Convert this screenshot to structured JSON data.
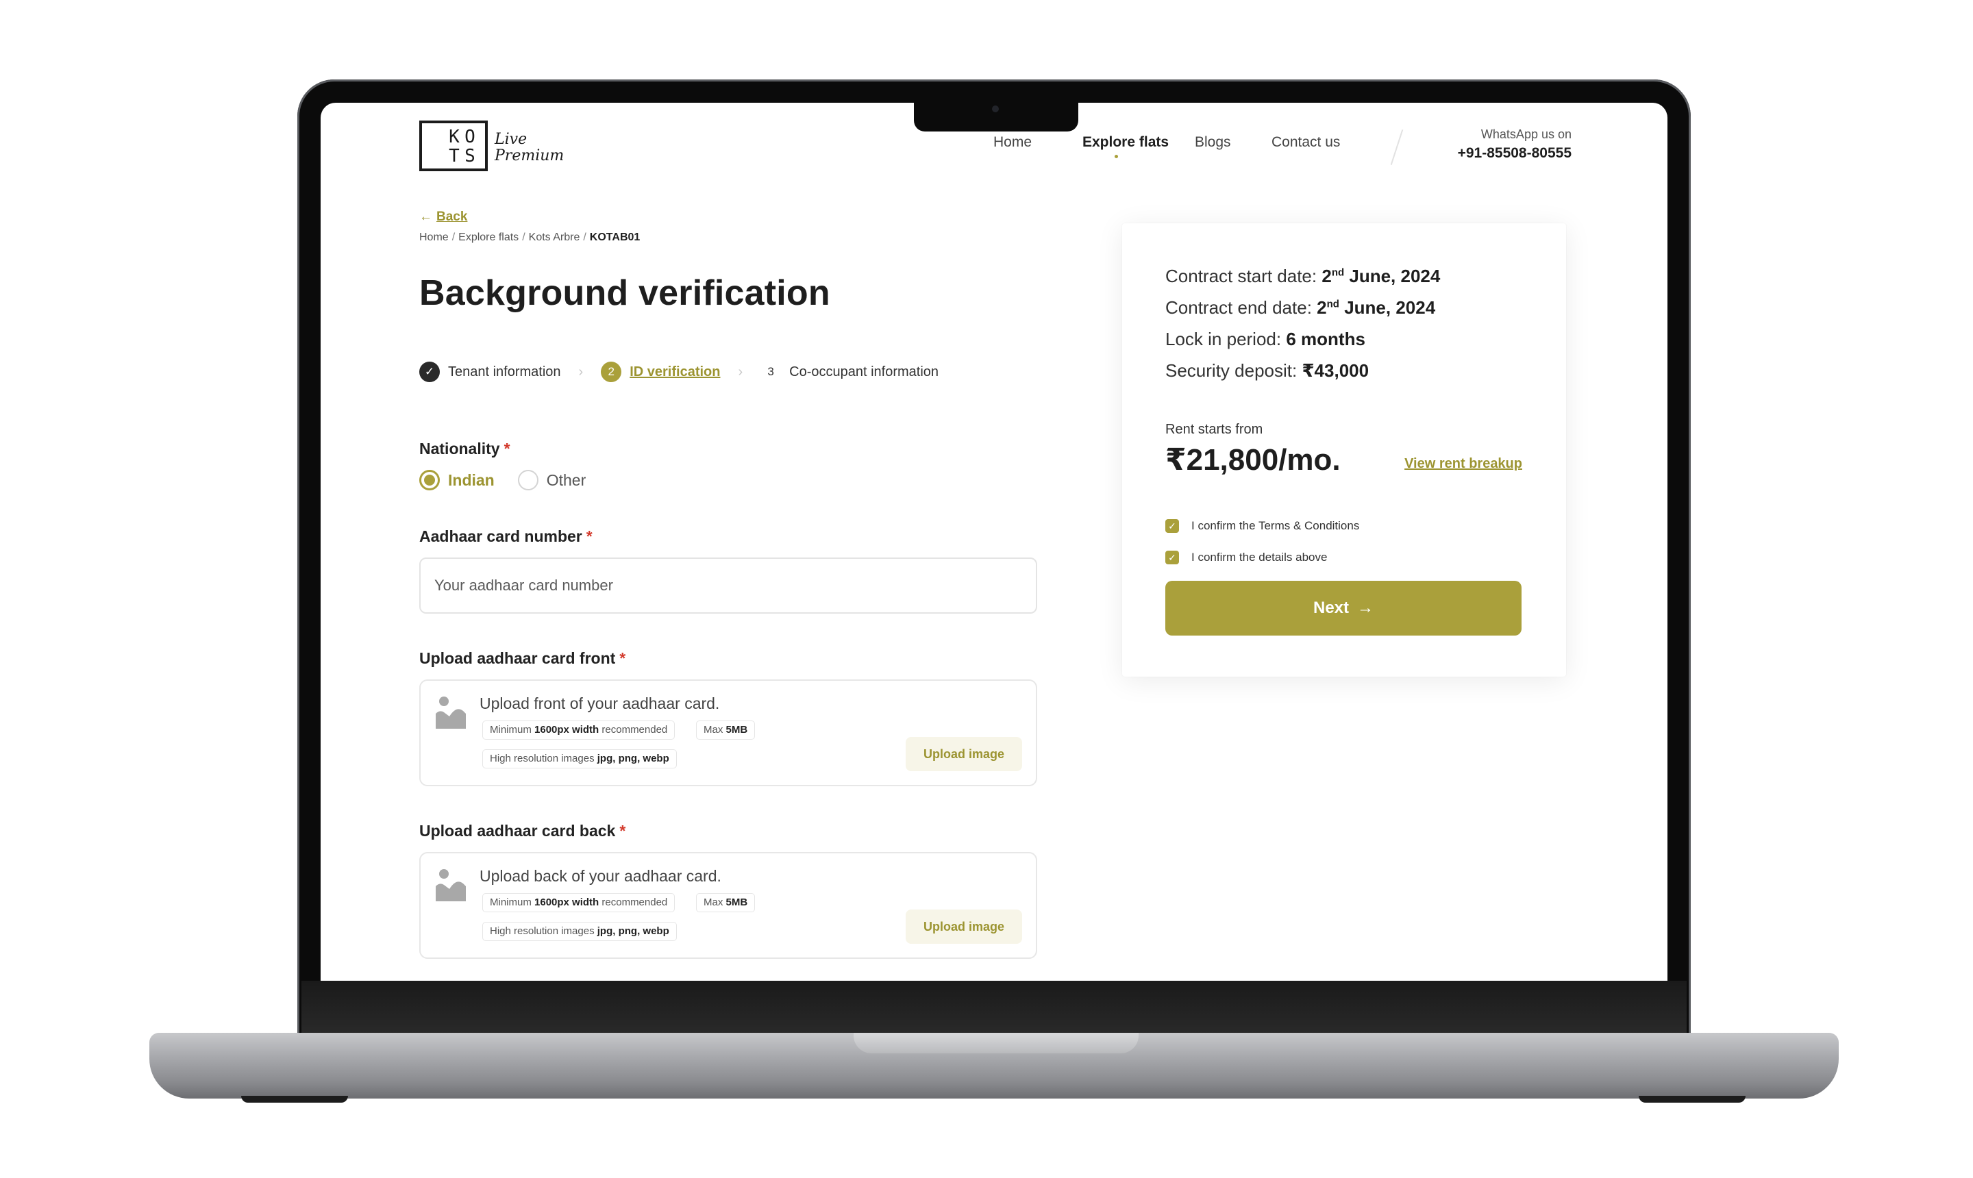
{
  "brand": {
    "logo_letters": [
      "K",
      "O",
      "T",
      "S"
    ],
    "logo_script_line1": "Live",
    "logo_script_line2": "Premium"
  },
  "nav": {
    "items": [
      {
        "label": "Home",
        "active": false
      },
      {
        "label": "Explore flats",
        "active": true
      },
      {
        "label": "Blogs",
        "active": false
      },
      {
        "label": "Contact us",
        "active": false
      }
    ],
    "whatsapp_label": "WhatsApp us on",
    "whatsapp_phone": "+91-85508-80555"
  },
  "back_label": "Back",
  "breadcrumb": [
    "Home",
    "Explore flats",
    "Kots Arbre",
    "KOTAB01"
  ],
  "page_title": "Background verification",
  "stepper": [
    {
      "number": "",
      "label": "Tenant information",
      "state": "done"
    },
    {
      "number": "2",
      "label": "ID verification",
      "state": "active"
    },
    {
      "number": "3",
      "label": "Co-occupant information",
      "state": "todo"
    }
  ],
  "form": {
    "nationality": {
      "label": "Nationality",
      "required_mark": "*",
      "options": [
        {
          "label": "Indian",
          "selected": true
        },
        {
          "label": "Other",
          "selected": false
        }
      ]
    },
    "aadhaar_number": {
      "label": "Aadhaar card number",
      "required_mark": "*",
      "value": "",
      "placeholder": "Your aadhaar card number"
    },
    "upload_front": {
      "label": "Upload aadhaar card front",
      "required_mark": "*",
      "title": "Upload front of your aadhaar card.",
      "chip_min_prefix": "Minimum",
      "chip_min_bold": "1600px width",
      "chip_min_suffix": "recommended",
      "chip_max_prefix": "Max",
      "chip_max_bold": "5MB",
      "chip_res_prefix": "High resolution images",
      "chip_res_bold": "jpg, png, webp",
      "button": "Upload image"
    },
    "upload_back": {
      "label": "Upload aadhaar card back",
      "required_mark": "*",
      "title": "Upload back of your aadhaar card.",
      "chip_min_prefix": "Minimum",
      "chip_min_bold": "1600px width",
      "chip_min_suffix": "recommended",
      "chip_max_prefix": "Max",
      "chip_max_bold": "5MB",
      "chip_res_prefix": "High resolution images",
      "chip_res_bold": "jpg, png, webp",
      "button": "Upload image"
    }
  },
  "summary": {
    "contract_start_label": "Contract start date:",
    "contract_start_day": "2",
    "contract_start_sup": "nd",
    "contract_start_rest": "June, 2024",
    "contract_end_label": "Contract end date:",
    "contract_end_day": "2",
    "contract_end_sup": "nd",
    "contract_end_rest": "June, 2024",
    "lock_in_label": "Lock in period:",
    "lock_in_value": "6 months",
    "deposit_label": "Security deposit:",
    "deposit_value": "₹43,000",
    "rent_label": "Rent starts from",
    "rent_amount": "₹21,800/mo.",
    "rent_breakup_link": "View rent breakup",
    "confirm_terms": "I confirm the Terms & Conditions",
    "confirm_terms_checked": true,
    "confirm_details": "I confirm the details above",
    "confirm_details_checked": true,
    "next_button": "Next",
    "next_icon": "arrow-right-icon"
  },
  "colors": {
    "accent": "#aaa03b",
    "accent_text": "#9c9431",
    "required": "#d33a2c",
    "text_dark": "#1e1e1e"
  }
}
